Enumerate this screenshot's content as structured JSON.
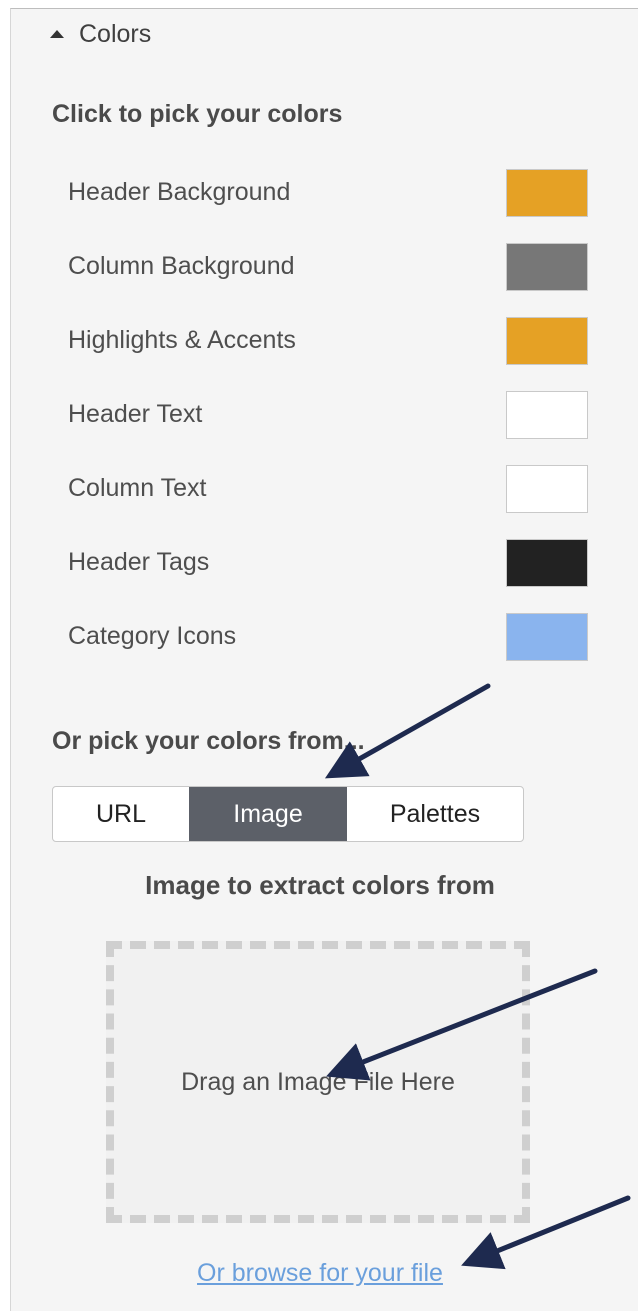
{
  "section": {
    "label": "Colors",
    "icon": "caret-up-icon"
  },
  "pick_heading": "Click to pick your colors",
  "color_rows": [
    {
      "label": "Header Background",
      "color": "#e5a125"
    },
    {
      "label": "Column Background",
      "color": "#777777"
    },
    {
      "label": "Highlights & Accents",
      "color": "#e5a125"
    },
    {
      "label": "Header Text",
      "color": "#ffffff"
    },
    {
      "label": "Column Text",
      "color": "#ffffff"
    },
    {
      "label": "Header Tags",
      "color": "#222222"
    },
    {
      "label": "Category Icons",
      "color": "#8ab4ee"
    }
  ],
  "from_heading": "Or pick your colors from...",
  "tabs": [
    {
      "label": "URL",
      "active": false
    },
    {
      "label": "Image",
      "active": true
    },
    {
      "label": "Palettes",
      "active": false
    }
  ],
  "image_heading": "Image to extract colors from",
  "dropzone_text": "Drag an Image File Here",
  "browse_link": "Or browse for your file",
  "annotation_color": "#1e2a4f"
}
